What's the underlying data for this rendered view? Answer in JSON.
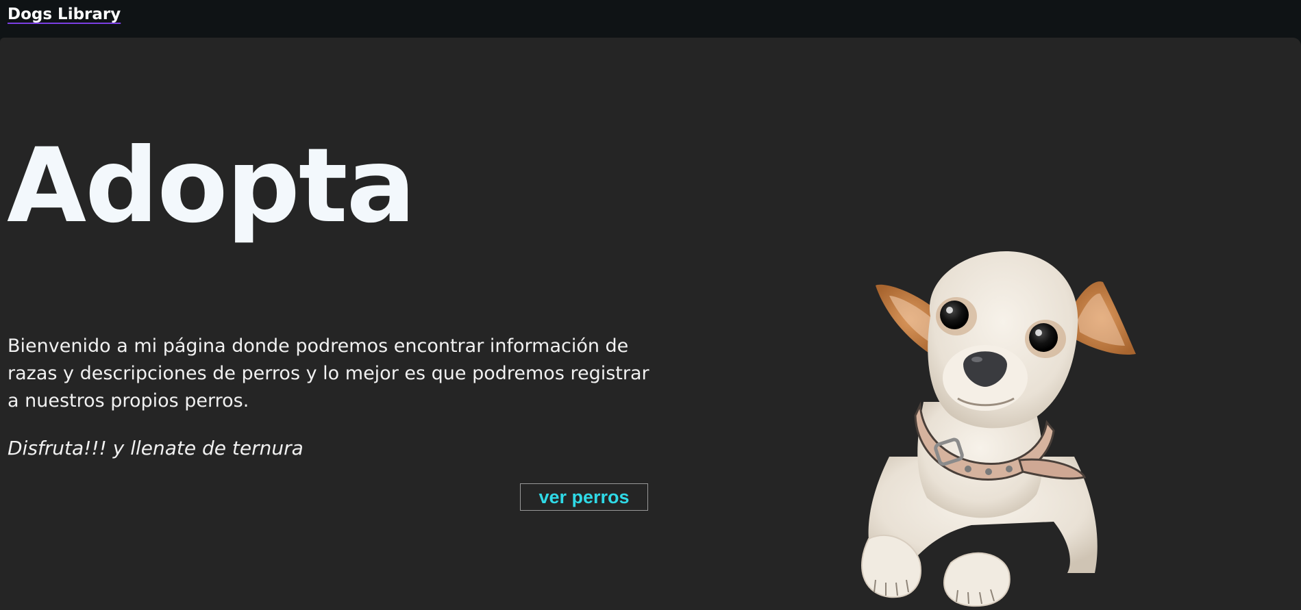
{
  "header": {
    "brand": "Dogs Library"
  },
  "hero": {
    "title": "Adopta",
    "intro": "Bienvenido a mi página donde podremos encontrar información de razas y descripciones de perros y lo mejor es que podremos registrar a nuestros propios perros.",
    "tagline": "Disfruta!!! y llenate de ternura",
    "cta_label": "ver perros"
  },
  "colors": {
    "page_background": "#252525",
    "header_background": "#0f1315",
    "title_text": "#f3f8fc",
    "cta_text": "#2fd9e6",
    "brand_underline": "#7b3fe4"
  }
}
